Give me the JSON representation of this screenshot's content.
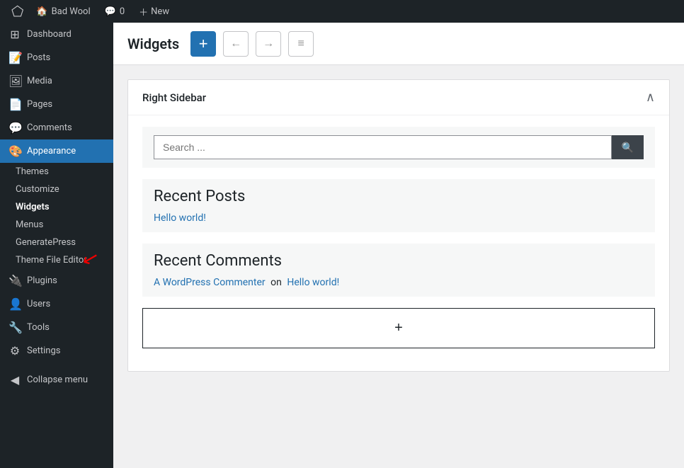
{
  "adminbar": {
    "logo_symbol": "W",
    "site_name": "Bad Wool",
    "comments_label": "Comments",
    "comments_count": "0",
    "new_label": "New"
  },
  "sidebar": {
    "dashboard_label": "Dashboard",
    "posts_label": "Posts",
    "media_label": "Media",
    "pages_label": "Pages",
    "comments_label": "Comments",
    "appearance_label": "Appearance",
    "themes_label": "Themes",
    "customize_label": "Customize",
    "widgets_label": "Widgets",
    "menus_label": "Menus",
    "generatepress_label": "GeneratePress",
    "theme_file_editor_label": "Theme File Editor",
    "plugins_label": "Plugins",
    "users_label": "Users",
    "tools_label": "Tools",
    "settings_label": "Settings",
    "collapse_label": "Collapse menu"
  },
  "header": {
    "title": "Widgets",
    "add_label": "+",
    "undo_label": "←",
    "redo_label": "→",
    "menu_label": "≡"
  },
  "widget_area": {
    "title": "Right Sidebar"
  },
  "search_widget": {
    "placeholder": "Search ...",
    "button_icon": "🔍"
  },
  "recent_posts_widget": {
    "title": "Recent Posts",
    "post_link": "Hello world!"
  },
  "recent_comments_widget": {
    "title": "Recent Comments",
    "commenter_link": "A WordPress Commenter",
    "on_text": "on",
    "post_link": "Hello world!"
  },
  "add_block": {
    "icon": "+"
  }
}
